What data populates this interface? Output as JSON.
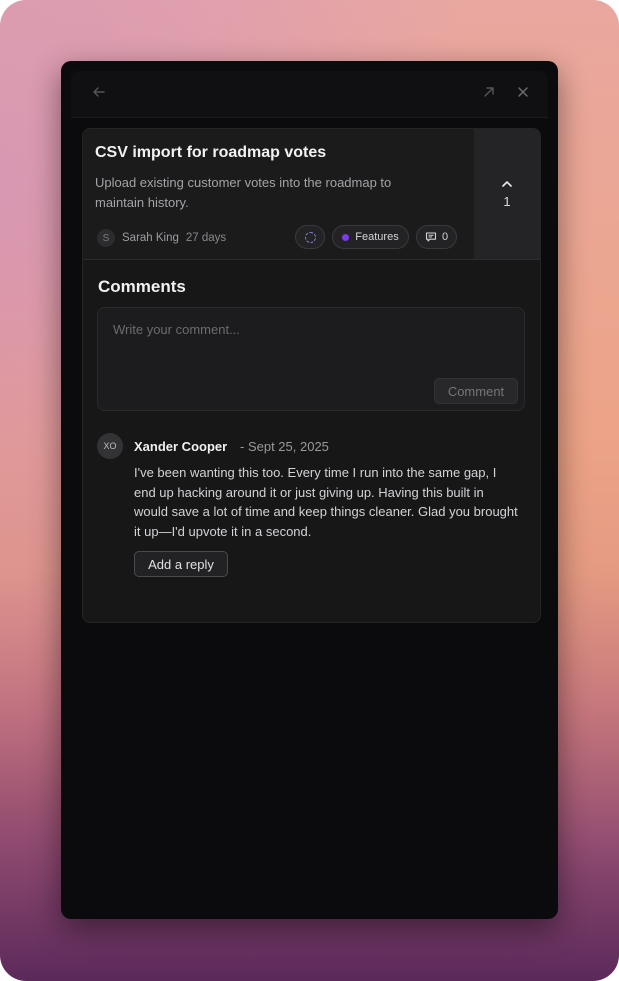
{
  "topbar": {
    "back_icon": "arrow-left-icon",
    "expand_icon": "arrow-up-right-icon",
    "close_icon": "close-icon"
  },
  "post": {
    "title": "CSV import for roadmap votes",
    "description": "Upload existing customer votes into the roadmap to maintain history.",
    "author_initial": "S",
    "author": "Sarah King",
    "time": "27 days",
    "category": "Features",
    "comment_count": "0",
    "vote_count": "1",
    "colors": {
      "category_dot": "#7c3aed",
      "status_ring": "#7f7fcf"
    }
  },
  "comments": {
    "title": "Comments",
    "placeholder": "Write your comment...",
    "submit_label": "Comment",
    "items": [
      {
        "initials": "XO",
        "name": "Xander Cooper",
        "date": "- Sept 25, 2025",
        "body": "I've been wanting this too. Every time I run into the same gap, I end up hacking around it or just giving up. Having this built in would save a lot of time and keep things cleaner. Glad you brought it up—I'd upvote it in a second.",
        "reply_label": "Add a reply"
      }
    ]
  }
}
